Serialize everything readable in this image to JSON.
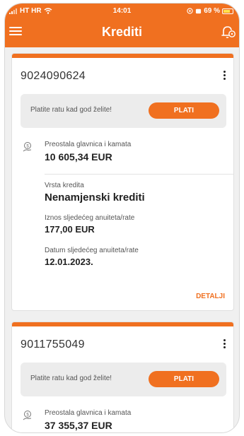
{
  "status_bar": {
    "carrier": "HT HR",
    "time": "14:01",
    "battery": "69 %"
  },
  "header": {
    "title": "Krediti"
  },
  "loans": [
    {
      "number": "9024090624",
      "pay_prompt": "Platite ratu kad god želite!",
      "pay_button": "PLATI",
      "remaining_label": "Preostala glavnica i kamata",
      "remaining_value": "10 605,34 EUR",
      "type_label": "Vrsta kredita",
      "type_value": "Nenamjenski krediti",
      "installment_label": "Iznos sljedećeg anuiteta/rate",
      "installment_value": "177,00 EUR",
      "date_label": "Datum sljedećeg anuiteta/rate",
      "date_value": "12.01.2023.",
      "details_link": "DETALJI"
    },
    {
      "number": "9011755049",
      "pay_prompt": "Platite ratu kad god želite!",
      "pay_button": "PLATI",
      "remaining_label": "Preostala glavnica i kamata",
      "remaining_value": "37 355,37 EUR"
    }
  ],
  "colors": {
    "accent": "#f07020",
    "background": "#f0f0f0",
    "card": "#ffffff"
  }
}
